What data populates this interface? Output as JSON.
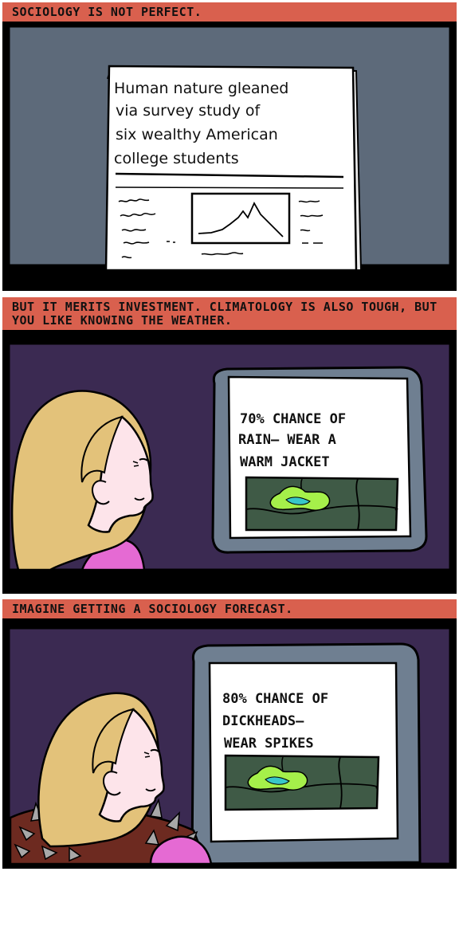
{
  "panels": [
    {
      "caption": "Sociology is not perfect.",
      "headline": [
        "Human nature gleaned",
        "via survey study of",
        "six wealthy American",
        "college students"
      ]
    },
    {
      "caption": "But it merits investment. Climatology is also tough, but you like knowing the weather.",
      "forecast": [
        "70% CHANCE OF",
        "RAIN— WEAR A",
        "WARM JACKET"
      ]
    },
    {
      "caption": "Imagine getting a sociology forecast.",
      "forecast": [
        "80% CHANCE OF",
        "DICKHEADS—",
        "WEAR SPIKES"
      ]
    }
  ],
  "colors": {
    "caption": "#d9604e",
    "panel1_bg": "#5d6a7a",
    "panel_bg_purple": "#3b2a52",
    "hair": "#e3c27a",
    "skin": "#fde4ea",
    "shirt": "#e56ad3",
    "monitor": "#6f7f91",
    "map": "#3f5a46",
    "rain_green": "#a5f04a",
    "rain_blue": "#38c7c9",
    "jacket": "#6d2a20",
    "spike": "#a8a8a8"
  }
}
